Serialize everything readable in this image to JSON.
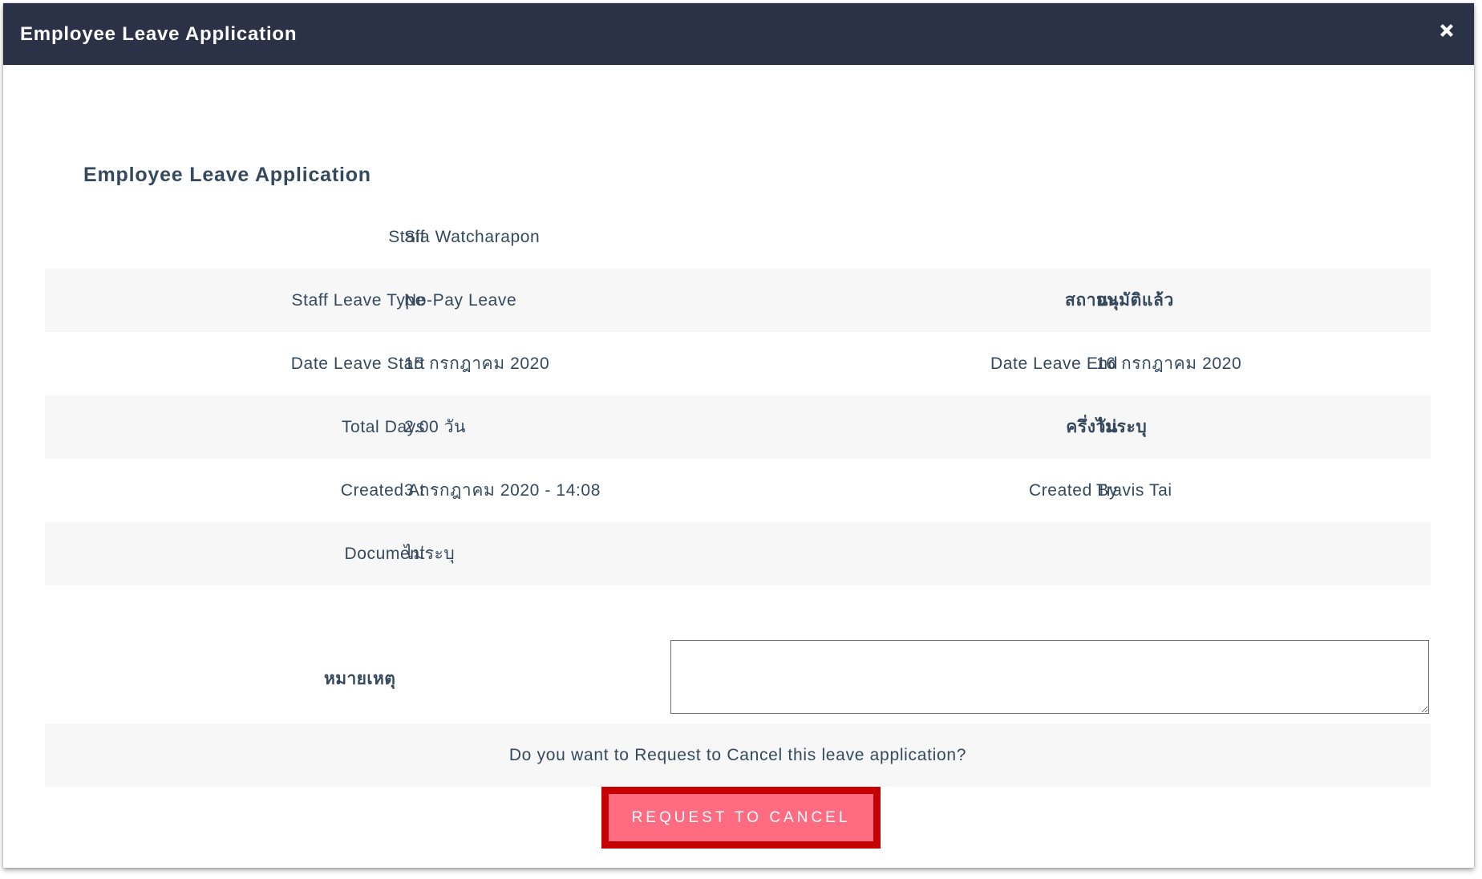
{
  "header": {
    "title": "Employee Leave Application"
  },
  "section": {
    "title": "Employee Leave Application"
  },
  "fields": {
    "staff_label": "Staff",
    "staff_value": "Sia Watcharapon",
    "leave_type_label": "Staff Leave Type",
    "leave_type_value": "No-Pay Leave",
    "status_label": "สถานะ",
    "status_value": "อนุมัติแล้ว",
    "date_start_label": "Date Leave Start",
    "date_start_value": "15 กรกฎาคม 2020",
    "date_end_label": "Date Leave End",
    "date_end_value": "16 กรกฎาคม 2020",
    "total_days_label": "Total Days",
    "total_days_value": "2.00 วัน",
    "half_day_label": "ครึ่งวัน",
    "half_day_value": "ไม่ระบุ",
    "created_at_label": "Created At",
    "created_at_value": "3 กรกฎาคม 2020 - 14:08",
    "created_by_label": "Created By",
    "created_by_value": "Travis Tai",
    "document_label": "Document",
    "document_value": "ไม่ระบุ"
  },
  "remark": {
    "label": "หมายเหตุ",
    "value": ""
  },
  "confirm": {
    "question": "Do you want to Request to Cancel this leave application?",
    "button_label": "REQUEST TO CANCEL"
  },
  "colors": {
    "header_bg": "#2b3247",
    "button_bg": "#ff6b81",
    "highlight_border": "#c40000",
    "row_shade": "#f7f7f7",
    "text": "#34495e"
  },
  "icons": {
    "close": "close-icon"
  }
}
